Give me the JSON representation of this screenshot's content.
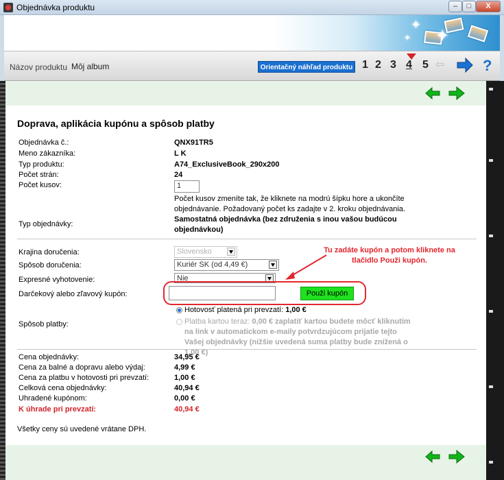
{
  "window": {
    "title": "Objednávka produktu",
    "min_label": "–",
    "max_label": "□",
    "close_label": "X"
  },
  "nav": {
    "product_name_label": "Názov produktu",
    "album_label": "Môj album",
    "preview_button": "Orientačný náhľad produktu",
    "steps": [
      "1",
      "2",
      "3",
      "4",
      "5"
    ],
    "active_step": "4",
    "help_label": "?"
  },
  "page": {
    "heading": "Doprava, aplikácia kupónu a spôsob platby",
    "order_no_label": "Objednávka č.:",
    "order_no_value": "QNX91TR5",
    "customer_label": "Meno zákazníka:",
    "customer_value": "L K",
    "product_type_label": "Typ produktu:",
    "product_type_value": "A74_ExclusiveBook_290x200",
    "pages_label": "Počet strán:",
    "pages_value": "24",
    "qty_label": "Počet kusov:",
    "qty_value": "1",
    "qty_note": "Počet kusov zmeníte tak, že kliknete na modrú šípku hore a ukončíte objednávanie. Požadovaný počet ks zadajte v 2. kroku objednávania.",
    "order_type_label": "Typ objednávky:",
    "order_type_value": "Samostatná objednávka (bez združenia s inou vašou budúcou objednávkou)",
    "country_label": "Krajina doručenia:",
    "country_value": "Slovensko",
    "delivery_label": "Spôsob doručenia:",
    "delivery_value": "Kuriér SK (od 4,49 €)",
    "express_label": "Expresné vyhotovenie:",
    "express_value": "Nie",
    "coupon_label": "Darčekový alebo zľavový kupón:",
    "coupon_value": "",
    "coupon_button": "Použi kupón",
    "annotation": "Tu zadáte kupón a potom kliknete na tlačidlo Použi kupón.",
    "payment_label": "Spôsob platby:",
    "payment_cash_text": "Hotovosť platená pri prevzatí:",
    "payment_cash_amount": "1,00 €",
    "payment_card_text": "Platba kartou teraz:",
    "payment_card_amount": "0,00 €",
    "payment_card_note": "zaplatiť kartou budete môcť kliknutím na link v automatickom e-maily potvrdzujúcom prijatie tejto Vašej objednávky (nižšie uvedená suma platby bude znížená o 1,00 €)",
    "totals": [
      {
        "label": "Cena objednávky:",
        "value": "34,95 €"
      },
      {
        "label": "Cena za balné a dopravu alebo výdaj:",
        "value": "4,99 €"
      },
      {
        "label": "Cena za platbu v hotovosti pri prevzatí:",
        "value": "1,00 €"
      },
      {
        "label": "Celková cena objednávky:",
        "value": "40,94 €"
      },
      {
        "label": "Uhradené kupónom:",
        "value": "0,00 €"
      },
      {
        "label": "K úhrade pri prevzatí:",
        "value": "40,94 €"
      }
    ],
    "footnote": "Všetky ceny sú uvedené vrátane DPH."
  },
  "colors": {
    "accent_red": "#e3262d",
    "accent_green": "#1fe11f",
    "accent_blue": "#1a6fd0"
  }
}
